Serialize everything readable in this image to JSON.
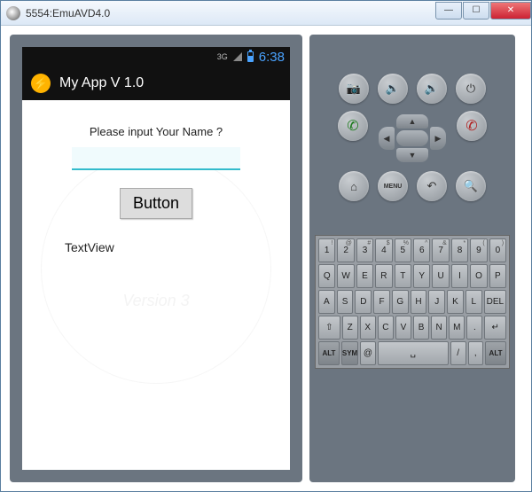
{
  "window": {
    "title": "5554:EmuAVD4.0",
    "min": "—",
    "max": "☐",
    "close": "✕"
  },
  "statusbar": {
    "network": "3G",
    "time": "6:38"
  },
  "app": {
    "icon_glyph": "⚡",
    "title": "My App V 1.0",
    "prompt": "Please input Your Name ?",
    "input_value": "",
    "button_label": "Button",
    "textview": "TextView",
    "watermark": "Version 3"
  },
  "controls": {
    "camera": "📷",
    "vol_down": "🔉",
    "vol_up": "🔊",
    "power": "⏻",
    "call": "✆",
    "end": "✆",
    "home": "⌂",
    "menu": "MENU",
    "back": "↶",
    "search": "🔍"
  },
  "keyboard": {
    "row1_sup": [
      "!",
      "@",
      "#",
      "$",
      "%",
      "^",
      "&",
      "*",
      "(",
      ")"
    ],
    "row1": [
      "1",
      "2",
      "3",
      "4",
      "5",
      "6",
      "7",
      "8",
      "9",
      "0"
    ],
    "row2": [
      "Q",
      "W",
      "E",
      "R",
      "T",
      "Y",
      "U",
      "I",
      "O",
      "P"
    ],
    "row3": [
      "A",
      "S",
      "D",
      "F",
      "G",
      "H",
      "J",
      "K",
      "L"
    ],
    "row3_del": "DEL",
    "row4_shift": "⇧",
    "row4": [
      "Z",
      "X",
      "C",
      "V",
      "B",
      "N",
      "M"
    ],
    "row4_period": ".",
    "row4_enter": "↵",
    "row5_alt1": "ALT",
    "row5_sym": "SYM",
    "row5_at": "@",
    "row5_space": "␣",
    "row5_slash": "/",
    "row5_comma": ",",
    "row5_alt2": "ALT"
  }
}
